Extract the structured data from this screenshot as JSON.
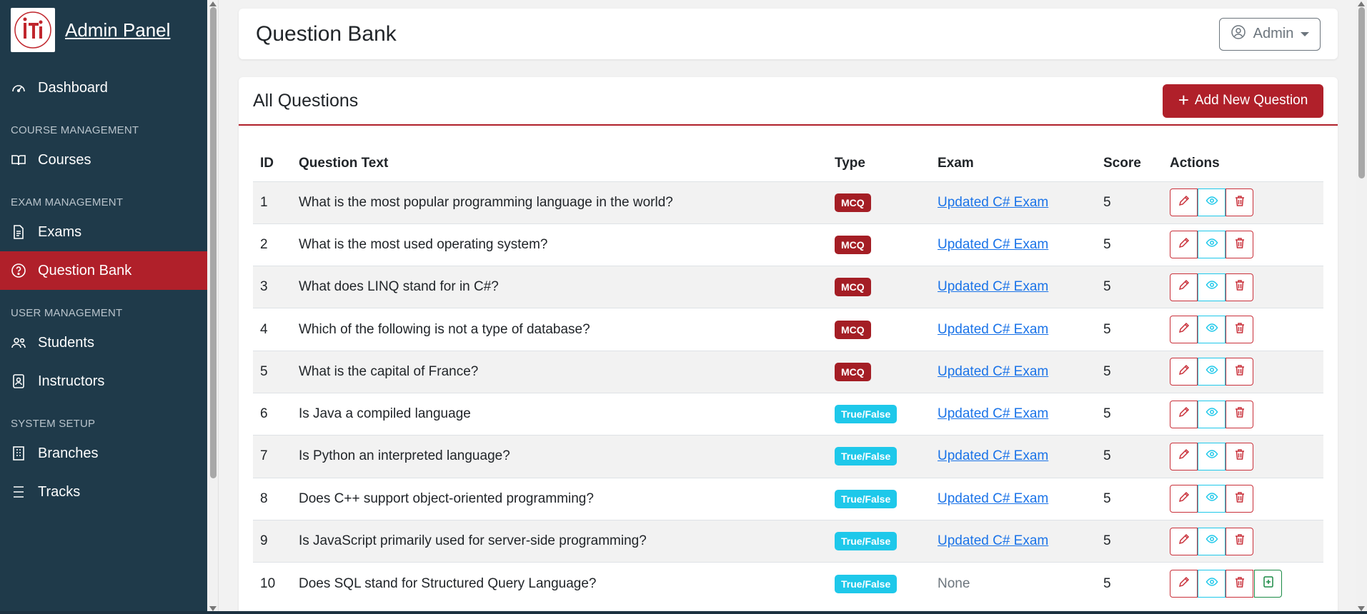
{
  "sidebar": {
    "brand_title": "Admin Panel",
    "dashboard": "Dashboard",
    "sections": {
      "course": "COURSE MANAGEMENT",
      "exam": "EXAM MANAGEMENT",
      "user": "USER MANAGEMENT",
      "system": "SYSTEM SETUP"
    },
    "items": {
      "courses": "Courses",
      "exams": "Exams",
      "question_bank": "Question Bank",
      "students": "Students",
      "instructors": "Instructors",
      "branches": "Branches",
      "tracks": "Tracks"
    }
  },
  "header": {
    "title": "Question Bank",
    "user_menu": "Admin"
  },
  "card": {
    "title": "All Questions",
    "add_button": "Add New Question"
  },
  "table": {
    "columns": [
      "ID",
      "Question Text",
      "Type",
      "Exam",
      "Score",
      "Actions"
    ],
    "rows": [
      {
        "id": "1",
        "text": "What is the most popular programming language in the world?",
        "type": "MCQ",
        "exam": "Updated C# Exam",
        "score": "5"
      },
      {
        "id": "2",
        "text": "What is the most used operating system?",
        "type": "MCQ",
        "exam": "Updated C# Exam",
        "score": "5"
      },
      {
        "id": "3",
        "text": "What does LINQ stand for in C#?",
        "type": "MCQ",
        "exam": "Updated C# Exam",
        "score": "5"
      },
      {
        "id": "4",
        "text": "Which of the following is not a type of database?",
        "type": "MCQ",
        "exam": "Updated C# Exam",
        "score": "5"
      },
      {
        "id": "5",
        "text": "What is the capital of France?",
        "type": "MCQ",
        "exam": "Updated C# Exam",
        "score": "5"
      },
      {
        "id": "6",
        "text": "Is Java a compiled language",
        "type": "True/False",
        "exam": "Updated C# Exam",
        "score": "5"
      },
      {
        "id": "7",
        "text": "Is Python an interpreted language?",
        "type": "True/False",
        "exam": "Updated C# Exam",
        "score": "5"
      },
      {
        "id": "8",
        "text": "Does C++ support object-oriented programming?",
        "type": "True/False",
        "exam": "Updated C# Exam",
        "score": "5"
      },
      {
        "id": "9",
        "text": "Is JavaScript primarily used for server-side programming?",
        "type": "True/False",
        "exam": "Updated C# Exam",
        "score": "5"
      },
      {
        "id": "10",
        "text": "Does SQL stand for Structured Query Language?",
        "type": "True/False",
        "exam": "None",
        "score": "5"
      }
    ]
  },
  "colors": {
    "sidebar_bg": "#1f3a4a",
    "accent": "#b0202a",
    "mcq_badge": "#a41e25",
    "tf_badge": "#1ec8ea",
    "link": "#1a73e8"
  }
}
